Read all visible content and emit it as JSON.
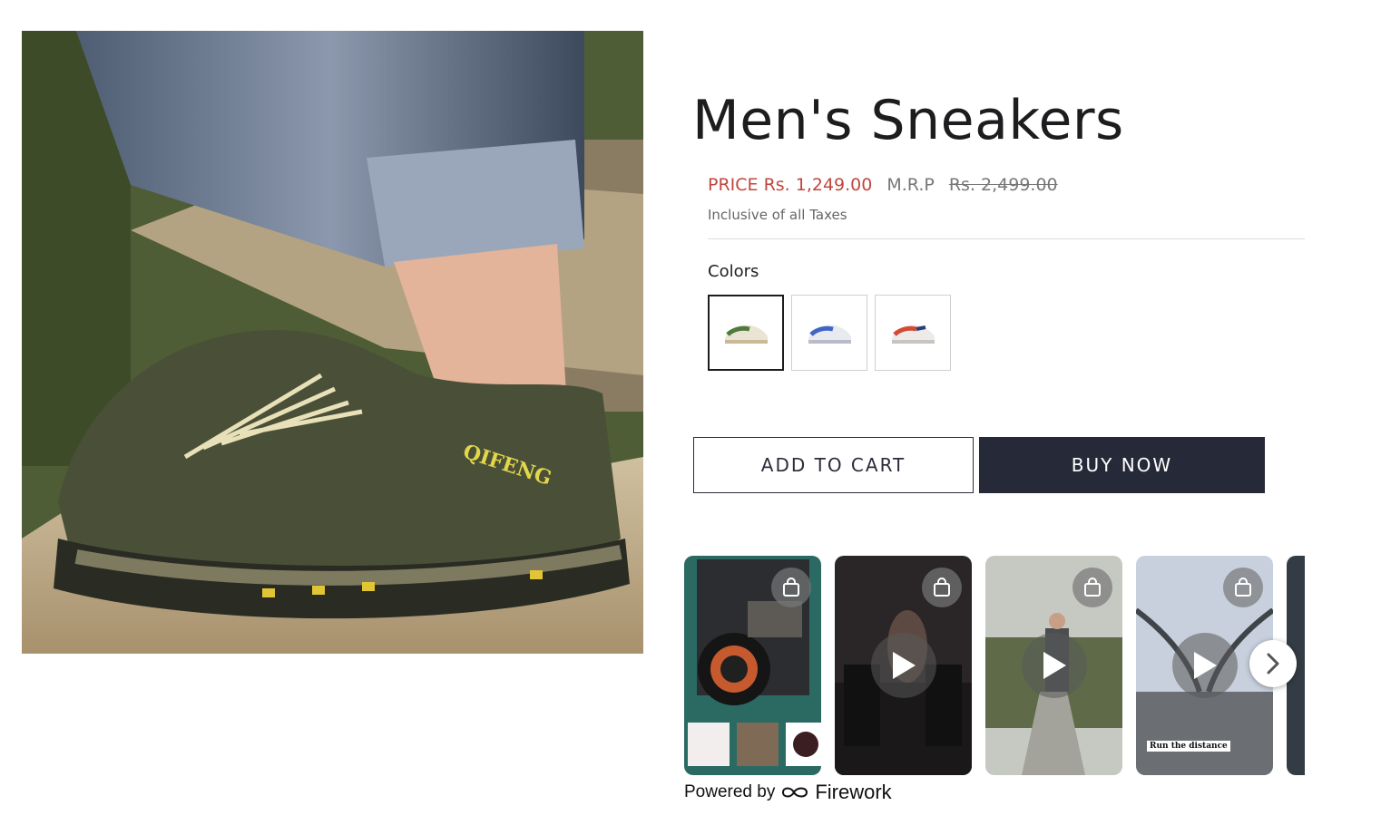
{
  "product": {
    "title": "Men's Sneakers",
    "price_label": "PRICE Rs. 1,249.00",
    "mrp_label": "M.R.P",
    "mrp_value": "Rs. 2,499.00",
    "tax_note": "Inclusive of all Taxes",
    "image_brand_text": "QIFENG",
    "colors_label": "Colors",
    "colors": [
      {
        "name": "green",
        "accent": "#4f7a3c",
        "selected": true
      },
      {
        "name": "blue",
        "accent": "#3f66c4",
        "selected": false
      },
      {
        "name": "red",
        "accent": "#d34a35",
        "selected": false
      }
    ]
  },
  "actions": {
    "add_to_cart": "ADD TO CART",
    "buy_now": "BUY NOW"
  },
  "videos": {
    "items": [
      {
        "subject": "camera"
      },
      {
        "subject": "treadmill"
      },
      {
        "subject": "walking"
      },
      {
        "subject": "bridge",
        "caption": "Run the distance"
      }
    ],
    "powered_by": "Powered by",
    "brand": "Firework"
  },
  "colors": {
    "sale_price": "#c0473f",
    "primary_button": "#262a38"
  }
}
